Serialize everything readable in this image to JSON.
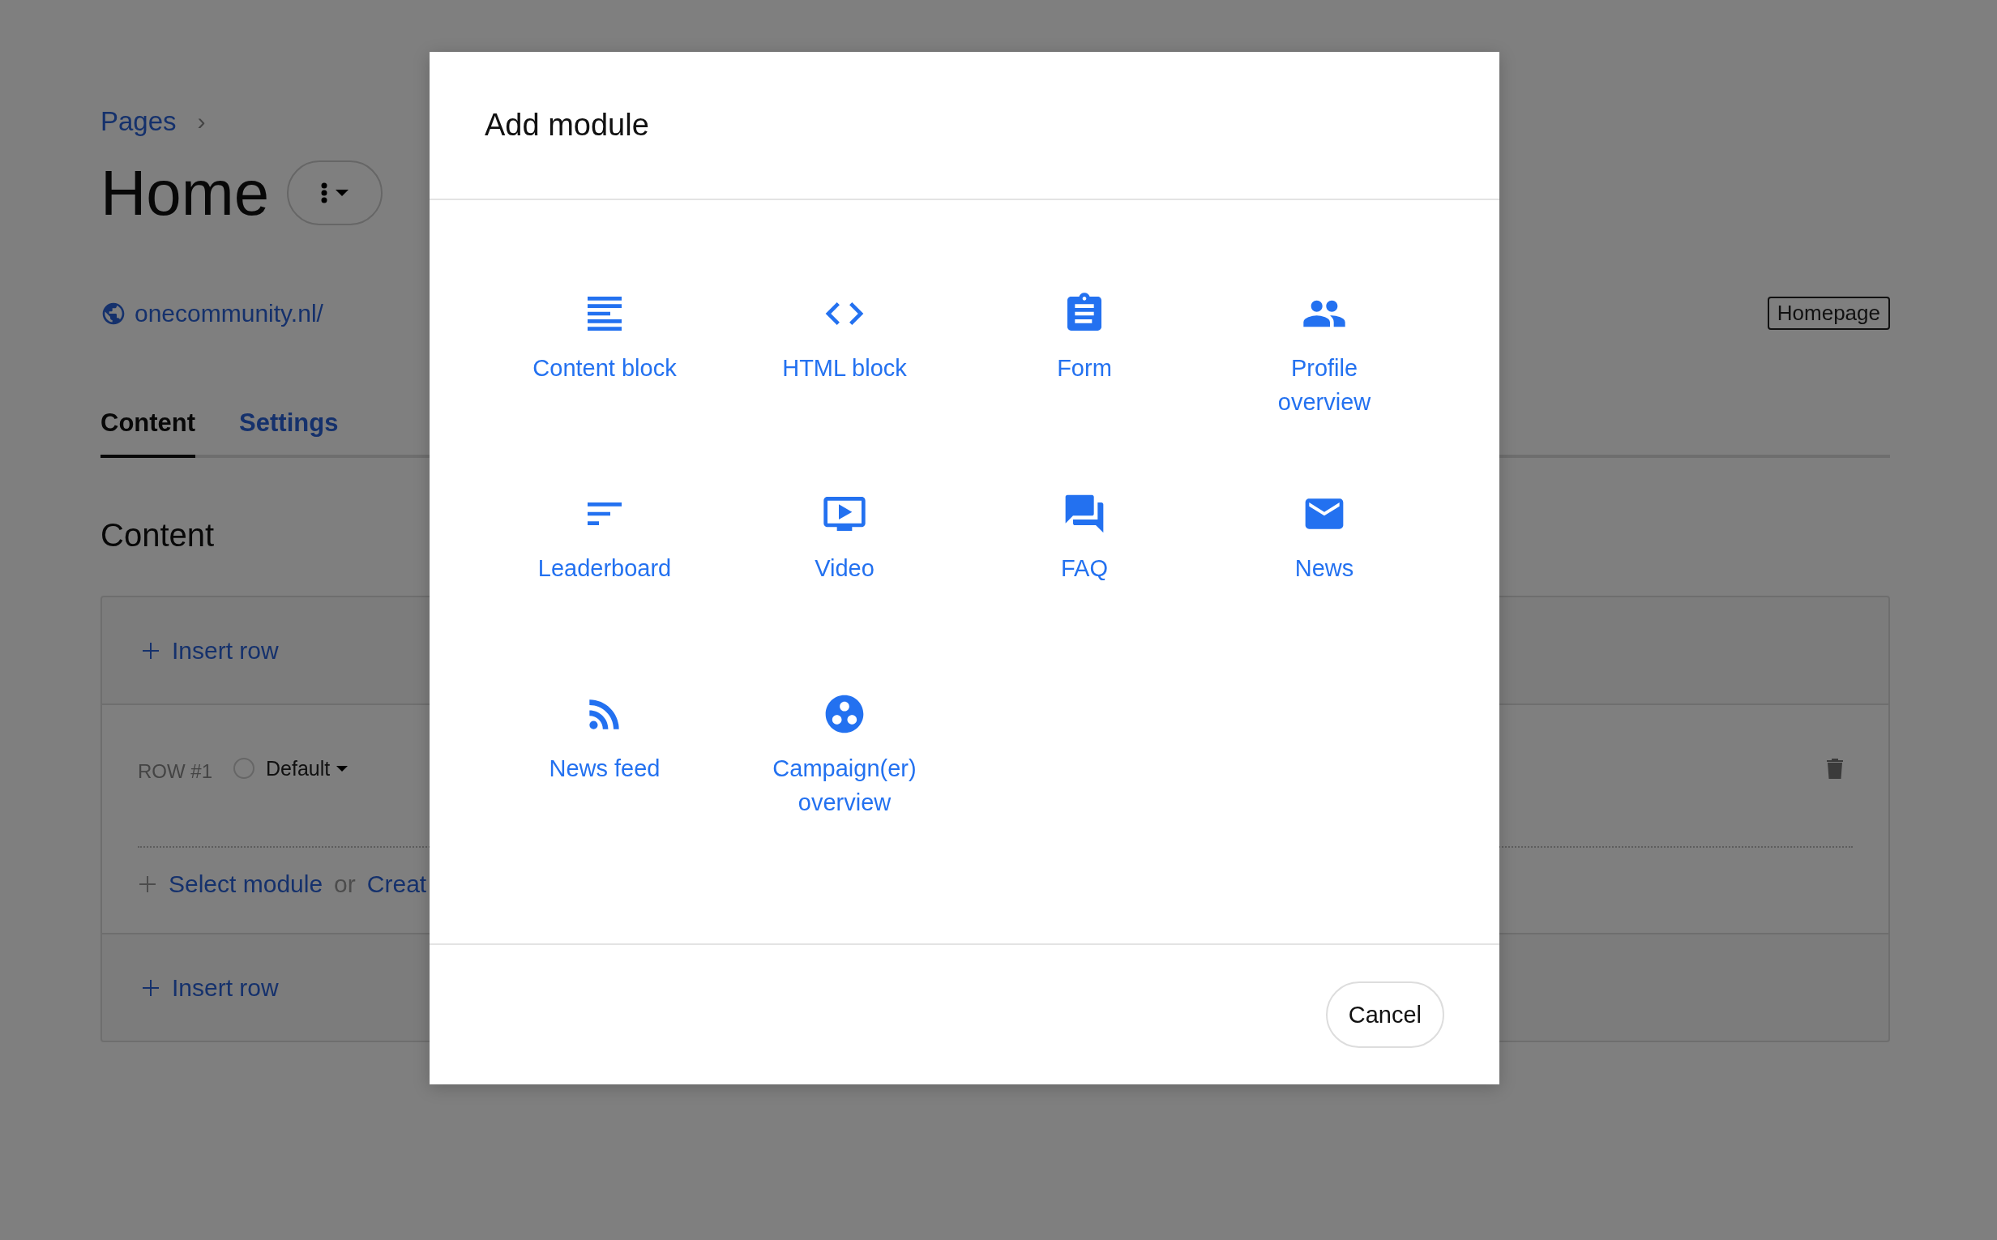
{
  "breadcrumb": {
    "items": [
      "Pages"
    ],
    "separator": "›"
  },
  "page_title": "Home",
  "site_link": "onecommunity.nl/",
  "page_badge": "Homepage",
  "tabs": [
    {
      "label": "Content",
      "selected": true
    },
    {
      "label": "Settings",
      "selected": false
    }
  ],
  "section_title": "Content",
  "editor": {
    "insert_row": "Insert row",
    "row": {
      "label": "ROW #1",
      "checked": false,
      "style": "Default"
    },
    "select_module": "Select module",
    "or": "or",
    "create": "Creat",
    "insert_row_bottom": "Insert row"
  },
  "dialog": {
    "title": "Add module",
    "modules": [
      {
        "kind": "content",
        "label": "Content block"
      },
      {
        "kind": "html",
        "label": "HTML block"
      },
      {
        "kind": "form",
        "label": "Form"
      },
      {
        "kind": "profile",
        "label": "Profile overview"
      },
      {
        "kind": "leaderboard",
        "label": "Leaderboard"
      },
      {
        "kind": "video",
        "label": "Video"
      },
      {
        "kind": "faq",
        "label": "FAQ"
      },
      {
        "kind": "news",
        "label": "News"
      },
      {
        "kind": "newsfeed",
        "label": "News feed"
      },
      {
        "kind": "campaign",
        "label": "Campaign(er) overview"
      }
    ],
    "cancel": "Cancel"
  }
}
